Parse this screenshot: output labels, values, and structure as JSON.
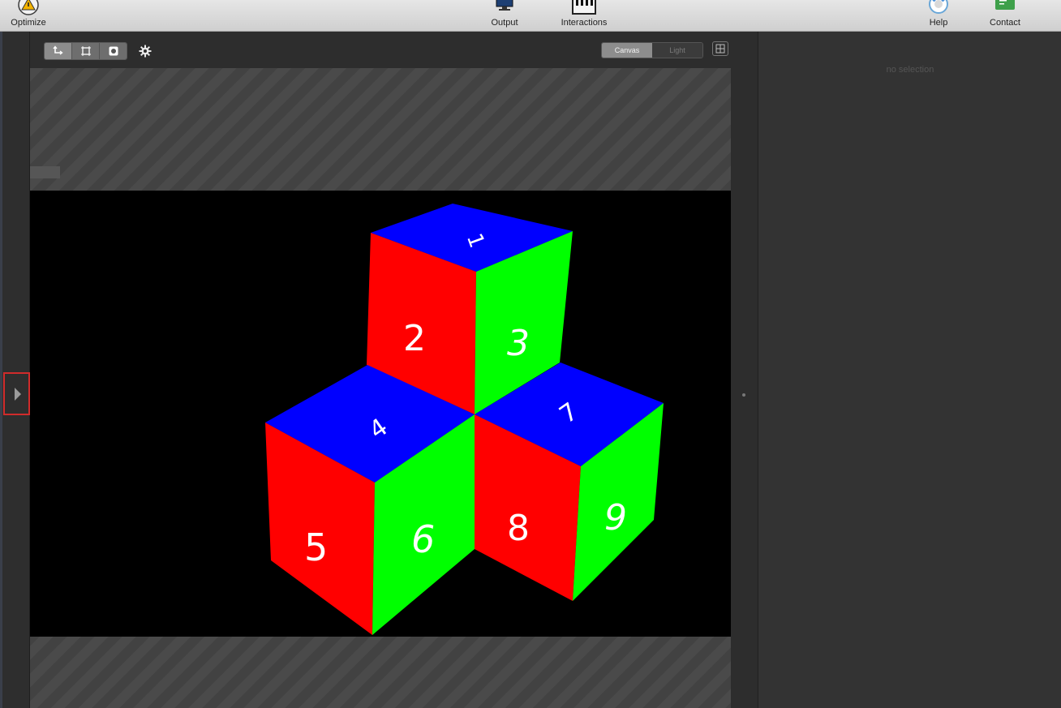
{
  "toolbar": {
    "optimize_label": "Optimize",
    "output_label": "Output",
    "interactions_label": "Interactions",
    "help_label": "Help",
    "contact_label": "Contact"
  },
  "viewport": {
    "tool_icons": [
      "move-icon",
      "frame-icon",
      "record-icon"
    ],
    "settings_icon": "gear-icon",
    "view_toggle": {
      "canvas_label": "Canvas",
      "light_label": "Light",
      "selected": "Canvas"
    },
    "grid_icon": "grid-icon"
  },
  "scene": {
    "colors": {
      "top": "#0000ff",
      "left": "#ff0000",
      "right": "#00ff00",
      "background": "#000000"
    },
    "face_numbers": [
      "1",
      "2",
      "3",
      "4",
      "5",
      "6",
      "7",
      "8",
      "9"
    ]
  },
  "inspector": {
    "empty_text": "no selection"
  }
}
